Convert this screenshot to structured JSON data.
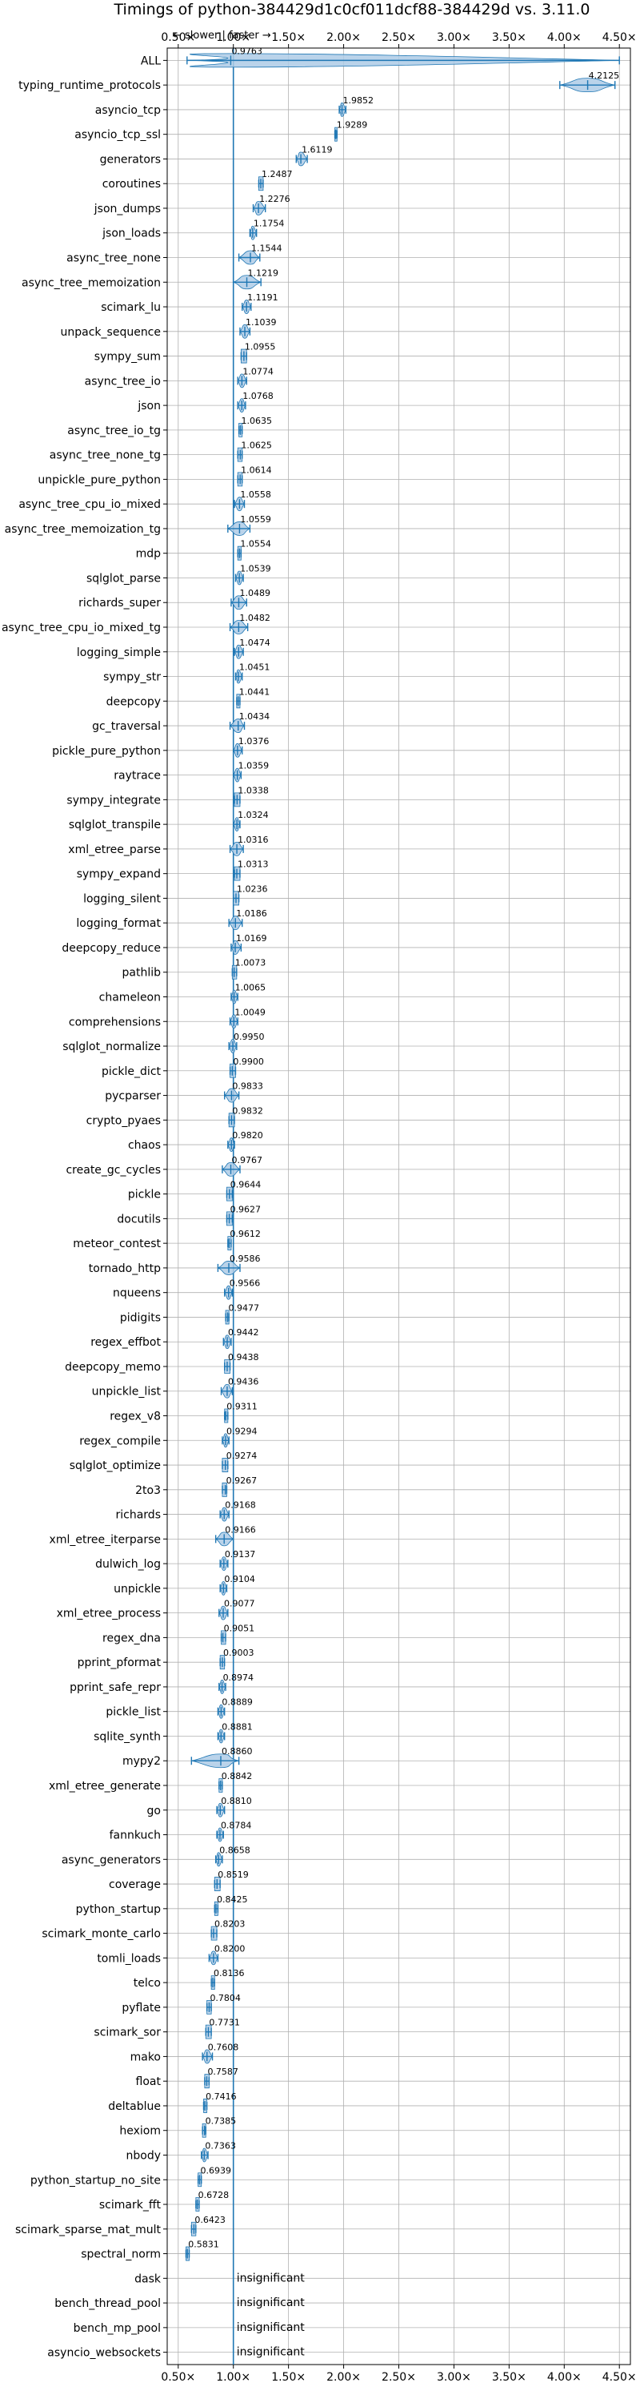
{
  "chart_data": {
    "type": "violin",
    "title": "Timings of python-384429d1c0cf011dcf88-384429d vs. 3.11.0",
    "direction_note": "← slower | faster →",
    "xlabel": "",
    "ylabel": "",
    "xlim": [
      0.4,
      4.6
    ],
    "x_ticks": [
      0.5,
      1.0,
      1.5,
      2.0,
      2.5,
      3.0,
      3.5,
      4.0,
      4.5
    ],
    "x_tick_labels": [
      "0.50×",
      "1.00×",
      "1.50×",
      "2.00×",
      "2.50×",
      "3.00×",
      "3.50×",
      "4.00×",
      "4.50×"
    ],
    "reference_line": 1.0,
    "grid": true,
    "insignificant_text": "insignificant",
    "categories": [
      "ALL",
      "typing_runtime_protocols",
      "asyncio_tcp",
      "asyncio_tcp_ssl",
      "generators",
      "coroutines",
      "json_dumps",
      "json_loads",
      "async_tree_none",
      "async_tree_memoization",
      "scimark_lu",
      "unpack_sequence",
      "sympy_sum",
      "async_tree_io",
      "json",
      "async_tree_io_tg",
      "async_tree_none_tg",
      "unpickle_pure_python",
      "async_tree_cpu_io_mixed",
      "async_tree_memoization_tg",
      "mdp",
      "sqlglot_parse",
      "richards_super",
      "async_tree_cpu_io_mixed_tg",
      "logging_simple",
      "sympy_str",
      "deepcopy",
      "gc_traversal",
      "pickle_pure_python",
      "raytrace",
      "sympy_integrate",
      "sqlglot_transpile",
      "xml_etree_parse",
      "sympy_expand",
      "logging_silent",
      "logging_format",
      "deepcopy_reduce",
      "pathlib",
      "chameleon",
      "comprehensions",
      "sqlglot_normalize",
      "pickle_dict",
      "pycparser",
      "crypto_pyaes",
      "chaos",
      "create_gc_cycles",
      "pickle",
      "docutils",
      "meteor_contest",
      "tornado_http",
      "nqueens",
      "pidigits",
      "regex_effbot",
      "deepcopy_memo",
      "unpickle_list",
      "regex_v8",
      "regex_compile",
      "sqlglot_optimize",
      "2to3",
      "richards",
      "xml_etree_iterparse",
      "dulwich_log",
      "unpickle",
      "xml_etree_process",
      "regex_dna",
      "pprint_pformat",
      "pprint_safe_repr",
      "pickle_list",
      "sqlite_synth",
      "mypy2",
      "xml_etree_generate",
      "go",
      "fannkuch",
      "async_generators",
      "coverage",
      "python_startup",
      "scimark_monte_carlo",
      "tomli_loads",
      "telco",
      "pyflate",
      "scimark_sor",
      "mako",
      "float",
      "deltablue",
      "hexiom",
      "nbody",
      "python_startup_no_site",
      "scimark_fft",
      "scimark_sparse_mat_mult",
      "spectral_norm",
      "dask",
      "bench_thread_pool",
      "bench_mp_pool",
      "asyncio_websockets"
    ],
    "values": [
      0.9763,
      4.2125,
      1.9852,
      1.9289,
      1.6119,
      1.2487,
      1.2276,
      1.1754,
      1.1544,
      1.1219,
      1.1191,
      1.1039,
      1.0955,
      1.0774,
      1.0768,
      1.0635,
      1.0625,
      1.0614,
      1.0558,
      1.0559,
      1.0554,
      1.0539,
      1.0489,
      1.0482,
      1.0474,
      1.0451,
      1.0441,
      1.0434,
      1.0376,
      1.0359,
      1.0338,
      1.0324,
      1.0316,
      1.0313,
      1.0236,
      1.0186,
      1.0169,
      1.0073,
      1.0065,
      1.0049,
      0.995,
      0.99,
      0.9833,
      0.9832,
      0.982,
      0.9767,
      0.9644,
      0.9627,
      0.9612,
      0.9586,
      0.9566,
      0.9477,
      0.9442,
      0.9438,
      0.9436,
      0.9311,
      0.9294,
      0.9274,
      0.9267,
      0.9168,
      0.9166,
      0.9137,
      0.9104,
      0.9077,
      0.9051,
      0.9003,
      0.8974,
      0.8889,
      0.8881,
      0.886,
      0.8842,
      0.881,
      0.8784,
      0.8658,
      0.8519,
      0.8425,
      0.8203,
      0.82,
      0.8136,
      0.7804,
      0.7731,
      0.7608,
      0.7587,
      0.7416,
      0.7385,
      0.7363,
      0.6939,
      0.6728,
      0.6423,
      0.5831,
      null,
      null,
      null,
      null
    ],
    "ranges": [
      [
        0.58,
        4.5
      ],
      [
        3.96,
        4.46
      ],
      [
        1.96,
        2.02
      ],
      [
        1.92,
        1.94
      ],
      [
        1.57,
        1.67
      ],
      [
        1.23,
        1.27
      ],
      [
        1.18,
        1.29
      ],
      [
        1.15,
        1.21
      ],
      [
        1.05,
        1.24
      ],
      [
        1.0,
        1.25
      ],
      [
        1.08,
        1.16
      ],
      [
        1.06,
        1.15
      ],
      [
        1.07,
        1.12
      ],
      [
        1.04,
        1.12
      ],
      [
        1.04,
        1.11
      ],
      [
        1.05,
        1.08
      ],
      [
        1.04,
        1.08
      ],
      [
        1.04,
        1.08
      ],
      [
        1.01,
        1.1
      ],
      [
        0.95,
        1.15
      ],
      [
        1.04,
        1.07
      ],
      [
        1.02,
        1.09
      ],
      [
        0.98,
        1.12
      ],
      [
        0.97,
        1.13
      ],
      [
        1.01,
        1.09
      ],
      [
        1.02,
        1.08
      ],
      [
        1.03,
        1.06
      ],
      [
        0.97,
        1.1
      ],
      [
        1.0,
        1.08
      ],
      [
        1.0,
        1.07
      ],
      [
        1.01,
        1.06
      ],
      [
        1.0,
        1.06
      ],
      [
        0.97,
        1.09
      ],
      [
        1.01,
        1.06
      ],
      [
        1.0,
        1.05
      ],
      [
        0.96,
        1.08
      ],
      [
        0.98,
        1.07
      ],
      [
        0.99,
        1.03
      ],
      [
        0.98,
        1.04
      ],
      [
        0.97,
        1.04
      ],
      [
        0.96,
        1.03
      ],
      [
        0.97,
        1.02
      ],
      [
        0.92,
        1.05
      ],
      [
        0.96,
        1.01
      ],
      [
        0.95,
        1.01
      ],
      [
        0.9,
        1.06
      ],
      [
        0.94,
        0.99
      ],
      [
        0.94,
        0.99
      ],
      [
        0.95,
        0.98
      ],
      [
        0.86,
        1.06
      ],
      [
        0.92,
        0.99
      ],
      [
        0.93,
        0.96
      ],
      [
        0.91,
        0.98
      ],
      [
        0.92,
        0.97
      ],
      [
        0.89,
        0.99
      ],
      [
        0.92,
        0.95
      ],
      [
        0.9,
        0.96
      ],
      [
        0.9,
        0.95
      ],
      [
        0.9,
        0.94
      ],
      [
        0.88,
        0.96
      ],
      [
        0.84,
        1.0
      ],
      [
        0.88,
        0.95
      ],
      [
        0.88,
        0.94
      ],
      [
        0.87,
        0.95
      ],
      [
        0.89,
        0.93
      ],
      [
        0.88,
        0.92
      ],
      [
        0.87,
        0.93
      ],
      [
        0.86,
        0.92
      ],
      [
        0.86,
        0.92
      ],
      [
        0.62,
        1.05
      ],
      [
        0.87,
        0.9
      ],
      [
        0.85,
        0.92
      ],
      [
        0.85,
        0.91
      ],
      [
        0.84,
        0.9
      ],
      [
        0.83,
        0.88
      ],
      [
        0.83,
        0.86
      ],
      [
        0.8,
        0.85
      ],
      [
        0.78,
        0.86
      ],
      [
        0.8,
        0.83
      ],
      [
        0.76,
        0.8
      ],
      [
        0.75,
        0.8
      ],
      [
        0.72,
        0.81
      ],
      [
        0.74,
        0.78
      ],
      [
        0.73,
        0.76
      ],
      [
        0.72,
        0.75
      ],
      [
        0.71,
        0.77
      ],
      [
        0.68,
        0.71
      ],
      [
        0.66,
        0.69
      ],
      [
        0.62,
        0.66
      ],
      [
        0.57,
        0.6
      ],
      null,
      null,
      null,
      null
    ]
  }
}
